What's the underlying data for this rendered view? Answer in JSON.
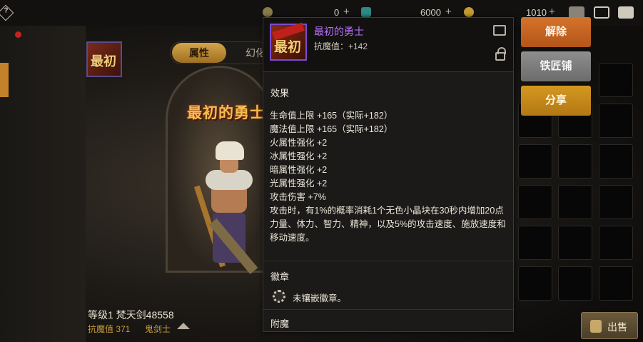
{
  "top_bar": {
    "currency_1": "0",
    "currency_2": "6000",
    "currency_3": "1010",
    "plus": "+"
  },
  "character": {
    "icon_label": "最初",
    "title_banner": "最初的勇士",
    "level_line": "等级1 梵天剑48558",
    "anti_demon": "抗魔值 371",
    "class_name": "鬼剑士"
  },
  "tabs": [
    {
      "label": "属性"
    },
    {
      "label": "幻化"
    }
  ],
  "tooltip": {
    "item_name": "最初的勇士",
    "icon_text": "最初",
    "anti_demon": "抗魔值：+142",
    "effects_title": "效果",
    "effects": [
      "生命值上限 +165（实际+182）",
      "魔法值上限 +165（实际+182）",
      "火属性强化 +2",
      "冰属性强化 +2",
      "暗属性强化 +2",
      "光属性强化 +2",
      "攻击伤害 +7%",
      "攻击时，有1%的概率消耗1个无色小晶块在30秒内增加20点",
      "力量、体力、智力、精神，以及5%的攻击速度、施放速度和",
      "移动速度。"
    ],
    "emblem_title": "徽章",
    "emblem_status": "未镶嵌徽章。",
    "enchant_title": "附魔"
  },
  "actions": {
    "release": "解除",
    "blacksmith": "铁匠铺",
    "share": "分享",
    "sell": "出售"
  },
  "colors": {
    "item_name": "#b872ff",
    "accent_orange": "#d4732a",
    "accent_gold": "#d4981f"
  }
}
